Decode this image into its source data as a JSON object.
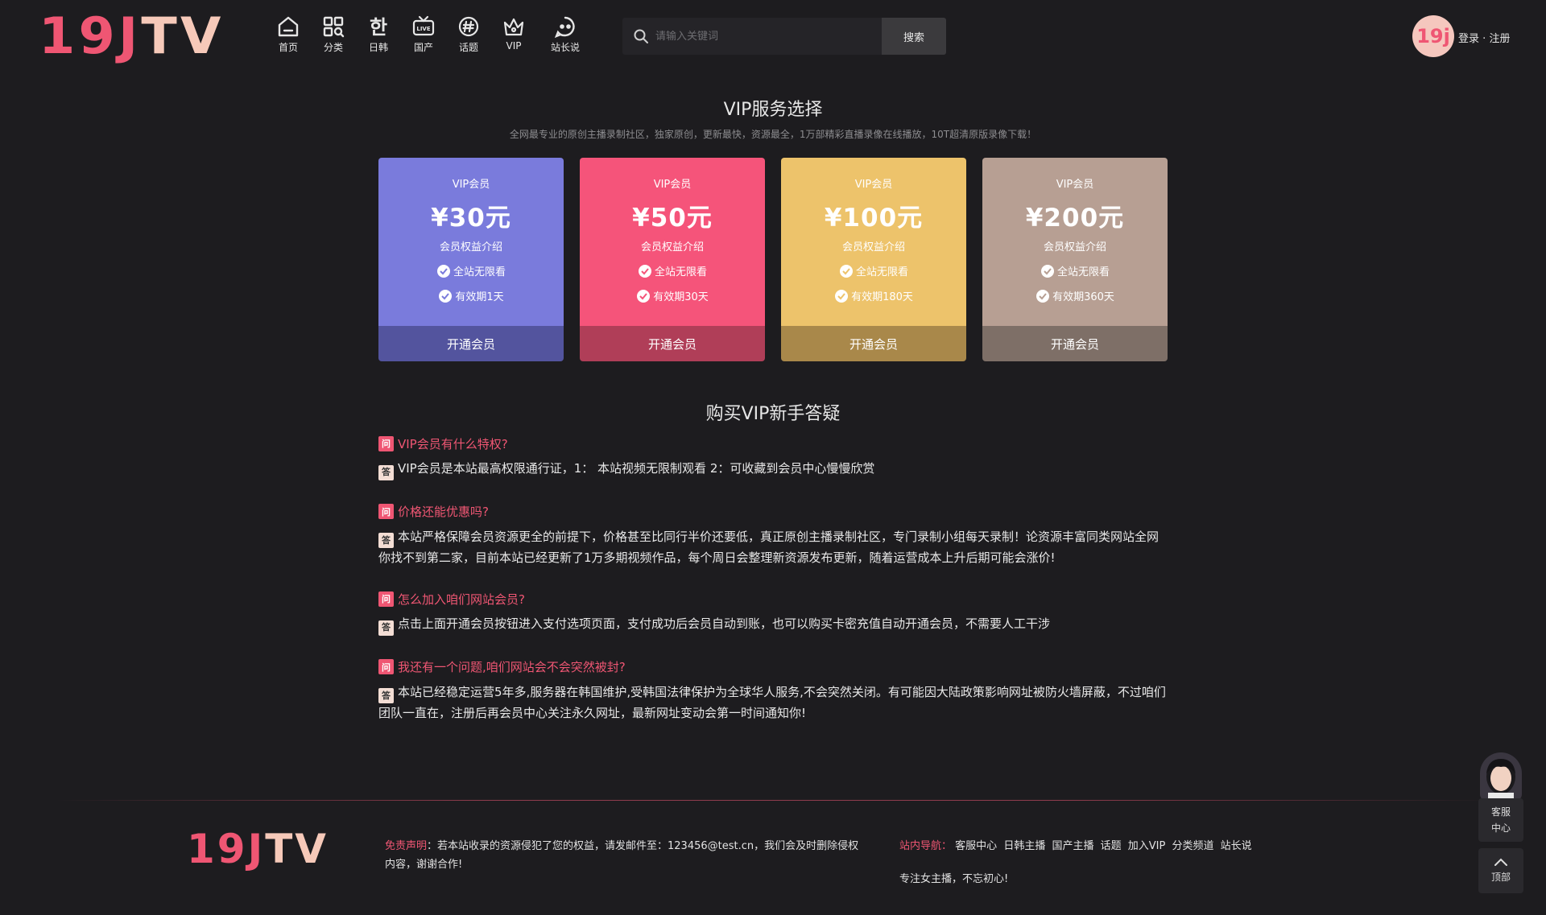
{
  "header": {
    "logo_a": "19J",
    "logo_b": "TV",
    "nav": [
      {
        "label": "首页",
        "icon": "home-icon"
      },
      {
        "label": "分类",
        "icon": "grid-icon"
      },
      {
        "label": "日韩",
        "icon": "hangul-icon"
      },
      {
        "label": "国产",
        "icon": "live-tv-icon"
      },
      {
        "label": "话题",
        "icon": "hashtag-icon"
      },
      {
        "label": "VIP",
        "icon": "crown-icon"
      },
      {
        "label": "站长说",
        "icon": "chat-icon"
      }
    ],
    "search_placeholder": "请输入关键词",
    "search_button": "搜索",
    "avatar_text": "19j",
    "login": "登录",
    "separator": "·",
    "register": "注册"
  },
  "vip": {
    "title": "VIP服务选择",
    "subtitle": "全网最专业的原创主播录制社区，独家原创，更新最快，资源最全，1万部精彩直播录像在线播放，10T超清原版录像下载！",
    "cards": [
      {
        "tier": "VIP会员",
        "price": "¥30元",
        "benefit": "会员权益介绍",
        "feature1": "全站无限看",
        "feature2": "有效期1天",
        "button": "开通会员",
        "color": "#7a7bdc",
        "button_color": "#53549e"
      },
      {
        "tier": "VIP会员",
        "price": "¥50元",
        "benefit": "会员权益介绍",
        "feature1": "全站无限看",
        "feature2": "有效期30天",
        "button": "开通会员",
        "color": "#f5547a",
        "button_color": "#b03e58"
      },
      {
        "tier": "VIP会员",
        "price": "¥100元",
        "benefit": "会员权益介绍",
        "feature1": "全站无限看",
        "feature2": "有效期180天",
        "button": "开通会员",
        "color": "#edc36b",
        "button_color": "#a9884a"
      },
      {
        "tier": "VIP会员",
        "price": "¥200元",
        "benefit": "会员权益介绍",
        "feature1": "全站无限看",
        "feature2": "有效期360天",
        "button": "开通会员",
        "color": "#b79f93",
        "button_color": "#7e6f67"
      }
    ]
  },
  "faq": {
    "title": "购买VIP新手答疑",
    "q_tag": "问",
    "a_tag": "答",
    "items": [
      {
        "q": "VIP会员有什么特权?",
        "a": "VIP会员是本站最高权限通行证，1： 本站视频无限制观看 2：可收藏到会员中心慢慢欣赏"
      },
      {
        "q": "价格还能优惠吗?",
        "a": "本站严格保障会员资源更全的前提下，价格甚至比同行半价还要低，真正原创主播录制社区，专门录制小组每天录制！论资源丰富同类网站全网你找不到第二家，目前本站已经更新了1万多期视频作品，每个周日会整理新资源发布更新，随着运营成本上升后期可能会涨价!"
      },
      {
        "q": "怎么加入咱们网站会员?",
        "a": "点击上面开通会员按钮进入支付选项页面，支付成功后会员自动到账，也可以购买卡密充值自动开通会员，不需要人工干涉"
      },
      {
        "q": "我还有一个问题,咱们网站会不会突然被封?",
        "a": "本站已经稳定运营5年多,服务器在韩国维护,受韩国法律保护为全球华人服务,不会突然关闭。有可能因大陆政策影响网址被防火墙屏蔽，不过咱们团队一直在，注册后再会员中心关注永久网址，最新网址变动会第一时间通知你!"
      }
    ]
  },
  "footer": {
    "logo_a": "19J",
    "logo_b": "TV",
    "disclaimer_label": "免责声明",
    "disclaimer_text": "：若本站收录的资源侵犯了您的权益，请发邮件至：123456@test.cn，我们会及时删除侵权内容，谢谢合作!",
    "nav_label": "站内导航：",
    "nav_links": [
      "客服中心",
      "日韩主播",
      "国产主播",
      "话题",
      "加入VIP",
      "分类频道",
      "站长说"
    ],
    "slogan": "专注女主播，不忘初心!"
  },
  "widgets": {
    "customer_service_line1": "客服",
    "customer_service_line2": "中心",
    "top": "顶部"
  }
}
